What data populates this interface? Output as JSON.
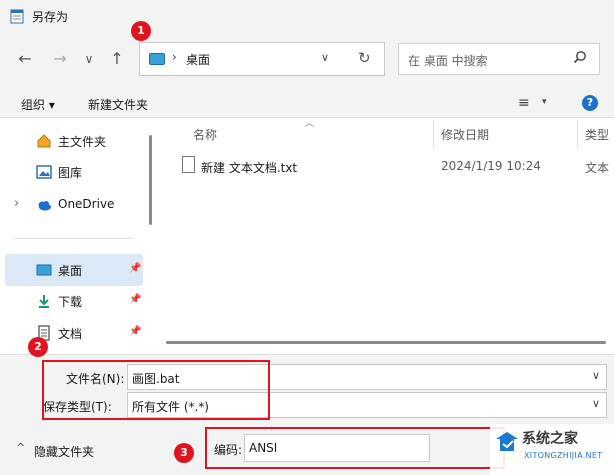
{
  "window": {
    "title": "另存为"
  },
  "nav": {
    "back": "←",
    "forward": "→",
    "recent": "∨",
    "up": "↑",
    "address": "桌面",
    "refresh": "↻",
    "dropdown": "∨"
  },
  "search": {
    "placeholder": "在 桌面 中搜索"
  },
  "toolbar": {
    "organize": "组织 ▾",
    "new_folder": "新建文件夹",
    "view": "≡",
    "view_dd": "▾",
    "help": "?"
  },
  "sidebar": {
    "items": [
      {
        "label": "主文件夹",
        "icon": "home-icon"
      },
      {
        "label": "图库",
        "icon": "gallery-icon"
      },
      {
        "label": "OneDrive",
        "icon": "cloud-icon",
        "expand": "›"
      },
      {
        "label": "桌面",
        "icon": "desktop-icon",
        "pinned": true
      },
      {
        "label": "下载",
        "icon": "download-icon",
        "pinned": true
      },
      {
        "label": "文档",
        "icon": "document-icon",
        "pinned": true
      }
    ]
  },
  "columns": {
    "name": "名称",
    "date": "修改日期",
    "type": "类型"
  },
  "files": [
    {
      "name": "新建 文本文档.txt",
      "date": "2024/1/19 10:24",
      "type": "文本"
    }
  ],
  "form": {
    "filename_label": "文件名(N):",
    "filename_value": "画图.bat",
    "filetype_label": "保存类型(T):",
    "filetype_value": "所有文件  (*.*)",
    "encoding_label": "编码:",
    "encoding_value": "ANSI"
  },
  "footer": {
    "hide_folders": "隐藏文件夹"
  },
  "badges": [
    "1",
    "2",
    "3"
  ],
  "watermark": {
    "brand": "系统之家",
    "url": "XITONGZHIJIA.NET"
  },
  "colors": {
    "highlight": "#e0141e",
    "selected": "#dbe8f6",
    "accent": "#1a73c8"
  }
}
